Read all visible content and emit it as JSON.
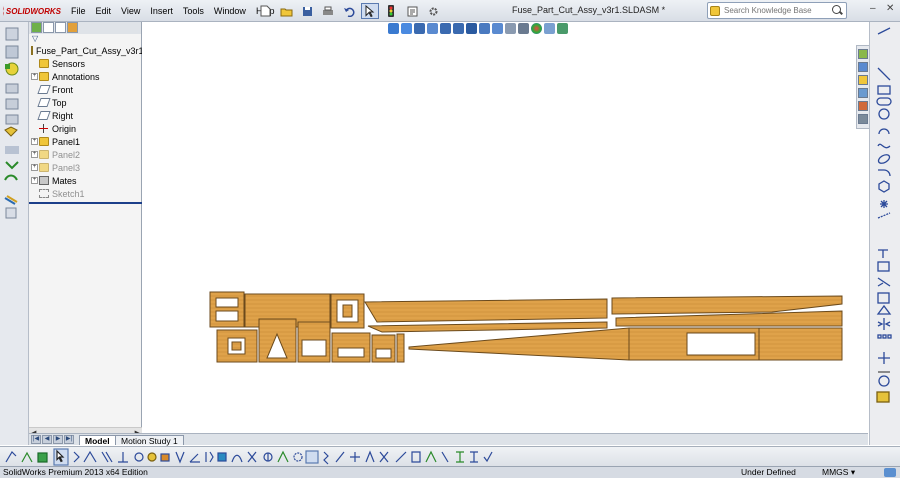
{
  "app": {
    "logo_text": "SOLIDWORKS",
    "document_title": "Fuse_Part_Cut_Assy_v3r1.SLDASM *",
    "accent_color": "#c00000"
  },
  "menu": {
    "items": [
      "File",
      "Edit",
      "View",
      "Insert",
      "Tools",
      "Window",
      "Help"
    ],
    "pin_icon": "pin-icon"
  },
  "search": {
    "placeholder": "Search Knowledge Base",
    "icon": "search-icon"
  },
  "feature_tree": {
    "root_label": "Fuse_Part_Cut_Assy_v3r1",
    "root_suffix": "(D",
    "items": [
      {
        "label": "Sensors",
        "icon": "folder-icon",
        "expandable": false,
        "dim": false
      },
      {
        "label": "Annotations",
        "icon": "annotation-icon",
        "expandable": true,
        "dim": false
      },
      {
        "label": "Front",
        "icon": "plane-icon",
        "expandable": false,
        "dim": false
      },
      {
        "label": "Top",
        "icon": "plane-icon",
        "expandable": false,
        "dim": false
      },
      {
        "label": "Right",
        "icon": "plane-icon",
        "expandable": false,
        "dim": false
      },
      {
        "label": "Origin",
        "icon": "origin-icon",
        "expandable": false,
        "dim": false
      },
      {
        "label": "Panel1",
        "icon": "part-icon",
        "expandable": true,
        "dim": false
      },
      {
        "label": "Panel2",
        "icon": "part-icon",
        "expandable": true,
        "dim": true
      },
      {
        "label": "Panel3",
        "icon": "part-icon",
        "expandable": true,
        "dim": true
      },
      {
        "label": "Mates",
        "icon": "mates-icon",
        "expandable": true,
        "dim": false
      },
      {
        "label": "Sketch1",
        "icon": "sketch-icon",
        "expandable": false,
        "dim": true
      }
    ]
  },
  "bottom_tabs": {
    "tabs": [
      "Model",
      "Motion Study 1"
    ],
    "active": "Model"
  },
  "status_bar": {
    "edition": "SolidWorks Premium 2013 x64 Edition",
    "sketch_state": "Under Defined",
    "units": "MMGS",
    "units_caret": "▾"
  },
  "window_controls": {
    "minimize": "–",
    "close": "✕"
  },
  "colors": {
    "wood": "#dfa24a",
    "wood_edge": "#6b4a1c",
    "selection": "#1c3f8a"
  }
}
